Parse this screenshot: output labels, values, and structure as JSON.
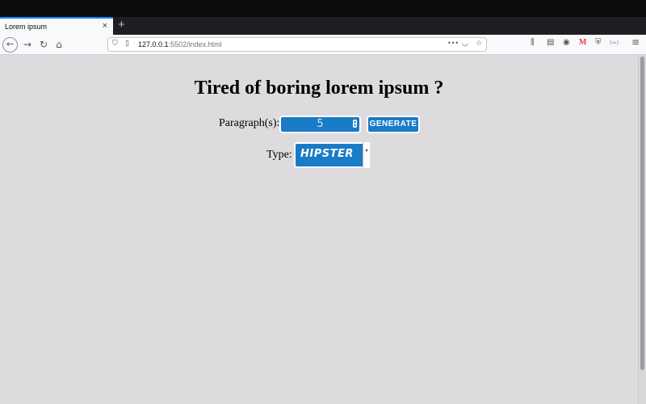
{
  "browser": {
    "tab_title": "Lorem ipsum",
    "tab_close": "×",
    "new_tab": "+",
    "url_host": "127.0.0.1",
    "url_path": ":5502/index.html",
    "nav": {
      "back": "←",
      "forward": "→",
      "reload": "↻",
      "home": "⌂"
    },
    "toolbar_icons": [
      "library-icon",
      "sidebar-icon",
      "account-icon",
      "gmail-icon",
      "shield-icon",
      "extension-icon",
      "menu-icon"
    ],
    "gmail_glyph": "M",
    "ext_glyph": "(∞)",
    "menu_glyph": "≡",
    "url_more": "•••"
  },
  "page": {
    "heading": "Tired of boring lorem ipsum ?",
    "paragraphs_label": "Paragraph(s):",
    "paragraphs_value": "5",
    "generate_label": "GENERATE",
    "type_label": "Type:",
    "type_value": "HIPSTER"
  },
  "colors": {
    "accent": "#1a7bc7",
    "background": "#dddbde",
    "tab_highlight": "#0a84ff"
  }
}
